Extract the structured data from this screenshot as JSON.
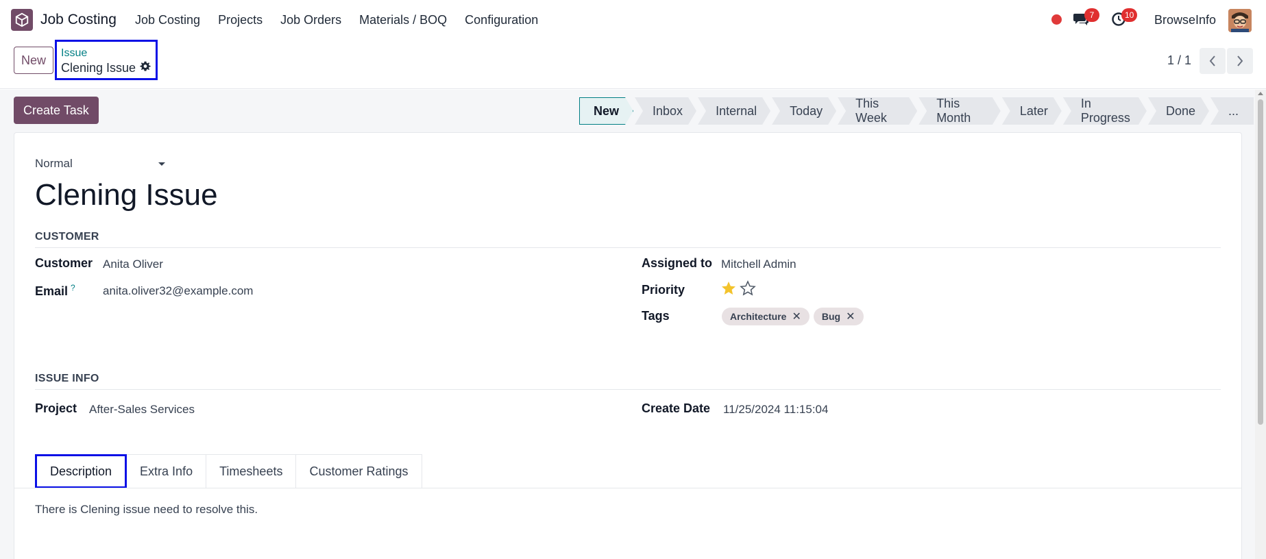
{
  "navbar": {
    "app_name": "Job Costing",
    "menu": [
      "Job Costing",
      "Projects",
      "Job Orders",
      "Materials / BOQ",
      "Configuration"
    ],
    "chat_count": "7",
    "activity_count": "10",
    "user_name": "BrowseInfo",
    "icons": {
      "apps": "box-icon",
      "chat": "chat-icon",
      "activity": "clock-icon",
      "status": "status-dot-icon"
    },
    "colors": {
      "brand": "#714b67",
      "badge": "#e02f2f"
    }
  },
  "control": {
    "new_label": "New",
    "breadcrumb_parent": "Issue",
    "breadcrumb_current": "Clening Issue",
    "pager": "1 / 1"
  },
  "actions": {
    "create_task_label": "Create Task"
  },
  "stages": [
    "New",
    "Inbox",
    "Internal",
    "Today",
    "This Week",
    "This Month",
    "Later",
    "In Progress",
    "Done",
    "..."
  ],
  "active_stage": "New",
  "form": {
    "priority_select": "Normal",
    "title": "Clening Issue",
    "customer_section": "CUSTOMER",
    "customer_label": "Customer",
    "customer_value": "Anita Oliver",
    "email_label": "Email",
    "email_help": "?",
    "email_value": "anita.oliver32@example.com",
    "assigned_label": "Assigned to",
    "assigned_value": "Mitchell Admin",
    "priority_label": "Priority",
    "priority_stars": 1,
    "priority_max": 2,
    "tags_label": "Tags",
    "tags": [
      "Architecture",
      "Bug"
    ],
    "issue_section": "ISSUE INFO",
    "project_label": "Project",
    "project_value": "After-Sales Services",
    "create_date_label": "Create Date",
    "create_date_value": "11/25/2024 11:15:04"
  },
  "tabs": [
    "Description",
    "Extra Info",
    "Timesheets",
    "Customer Ratings"
  ],
  "active_tab": "Description",
  "description": "There is Clening issue need to resolve this."
}
